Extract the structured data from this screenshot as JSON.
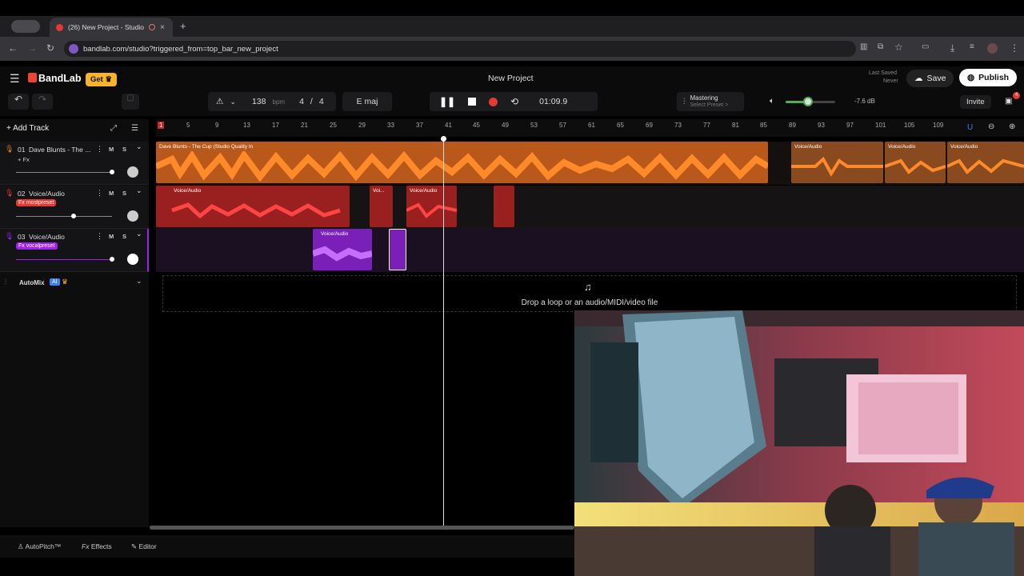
{
  "browser": {
    "active_tab_title": "(26) New Project - Studio",
    "url": "bandlab.com/studio?triggered_from=top_bar_new_project"
  },
  "app": {
    "brand": "BandLab",
    "get_label": "Get",
    "project_title": "New Project",
    "last_saved_label": "Last Saved",
    "last_saved_value": "Never",
    "save_label": "Save",
    "publish_label": "Publish",
    "invite_label": "Invite",
    "badge_count": "4"
  },
  "transport": {
    "bpm": "138",
    "bpm_unit": "bpm",
    "time_sig_num": "4",
    "time_sig_sep": "/",
    "time_sig_den": "4",
    "key": "E maj",
    "time": "01:09.9",
    "mastering_label": "Mastering",
    "preset_label": "Select Preset >",
    "volume_db": "-7.6 dB",
    "volume_level": 0.45
  },
  "sidebar": {
    "add_track_label": "Add Track",
    "tracks": [
      {
        "num": "01",
        "name": "Dave Blunts - The ...",
        "fx": "+ Fx",
        "m": "M",
        "s": "S",
        "color": "#f07f1d"
      },
      {
        "num": "02",
        "name": "Voice/Audio",
        "fx": "Fx mostpreset",
        "m": "M",
        "s": "S",
        "color": "#e53935"
      },
      {
        "num": "03",
        "name": "Voice/Audio",
        "fx": "Fx vocalpreset",
        "m": "M",
        "s": "S",
        "color": "#a020f0"
      }
    ],
    "automix_label": "AutoMix",
    "ai_label": "AI"
  },
  "ruler": {
    "ticks": [
      "5",
      "9",
      "13",
      "17",
      "21",
      "25",
      "29",
      "33",
      "37",
      "41",
      "45",
      "49",
      "53",
      "57",
      "61",
      "65",
      "69",
      "73",
      "77",
      "81",
      "85",
      "89",
      "93",
      "97",
      "101",
      "105",
      "109"
    ],
    "marker": "1"
  },
  "clips": {
    "track1_main": "Dave Blunts - The Cup (Studio Quality In",
    "track1_b": "Voice/Audio",
    "track1_c": "Voice/Audio",
    "track1_d": "Voice/Audio",
    "track2_a": "Voice/Audio",
    "track2_b": "Voi...",
    "track2_c": "Voice/Audio",
    "track3_a": "Voice/Audio"
  },
  "drop_zone_text": "Drop a loop or an audio/MIDI/video file",
  "footer": {
    "autopitch_label": "AutoPitch™",
    "effects_label": "Effects",
    "editor_label": "Editor"
  },
  "colors": {
    "orange": "#f07f1d",
    "red": "#e53935",
    "purple": "#a020f0",
    "accent_gold": "#f6b32b"
  }
}
